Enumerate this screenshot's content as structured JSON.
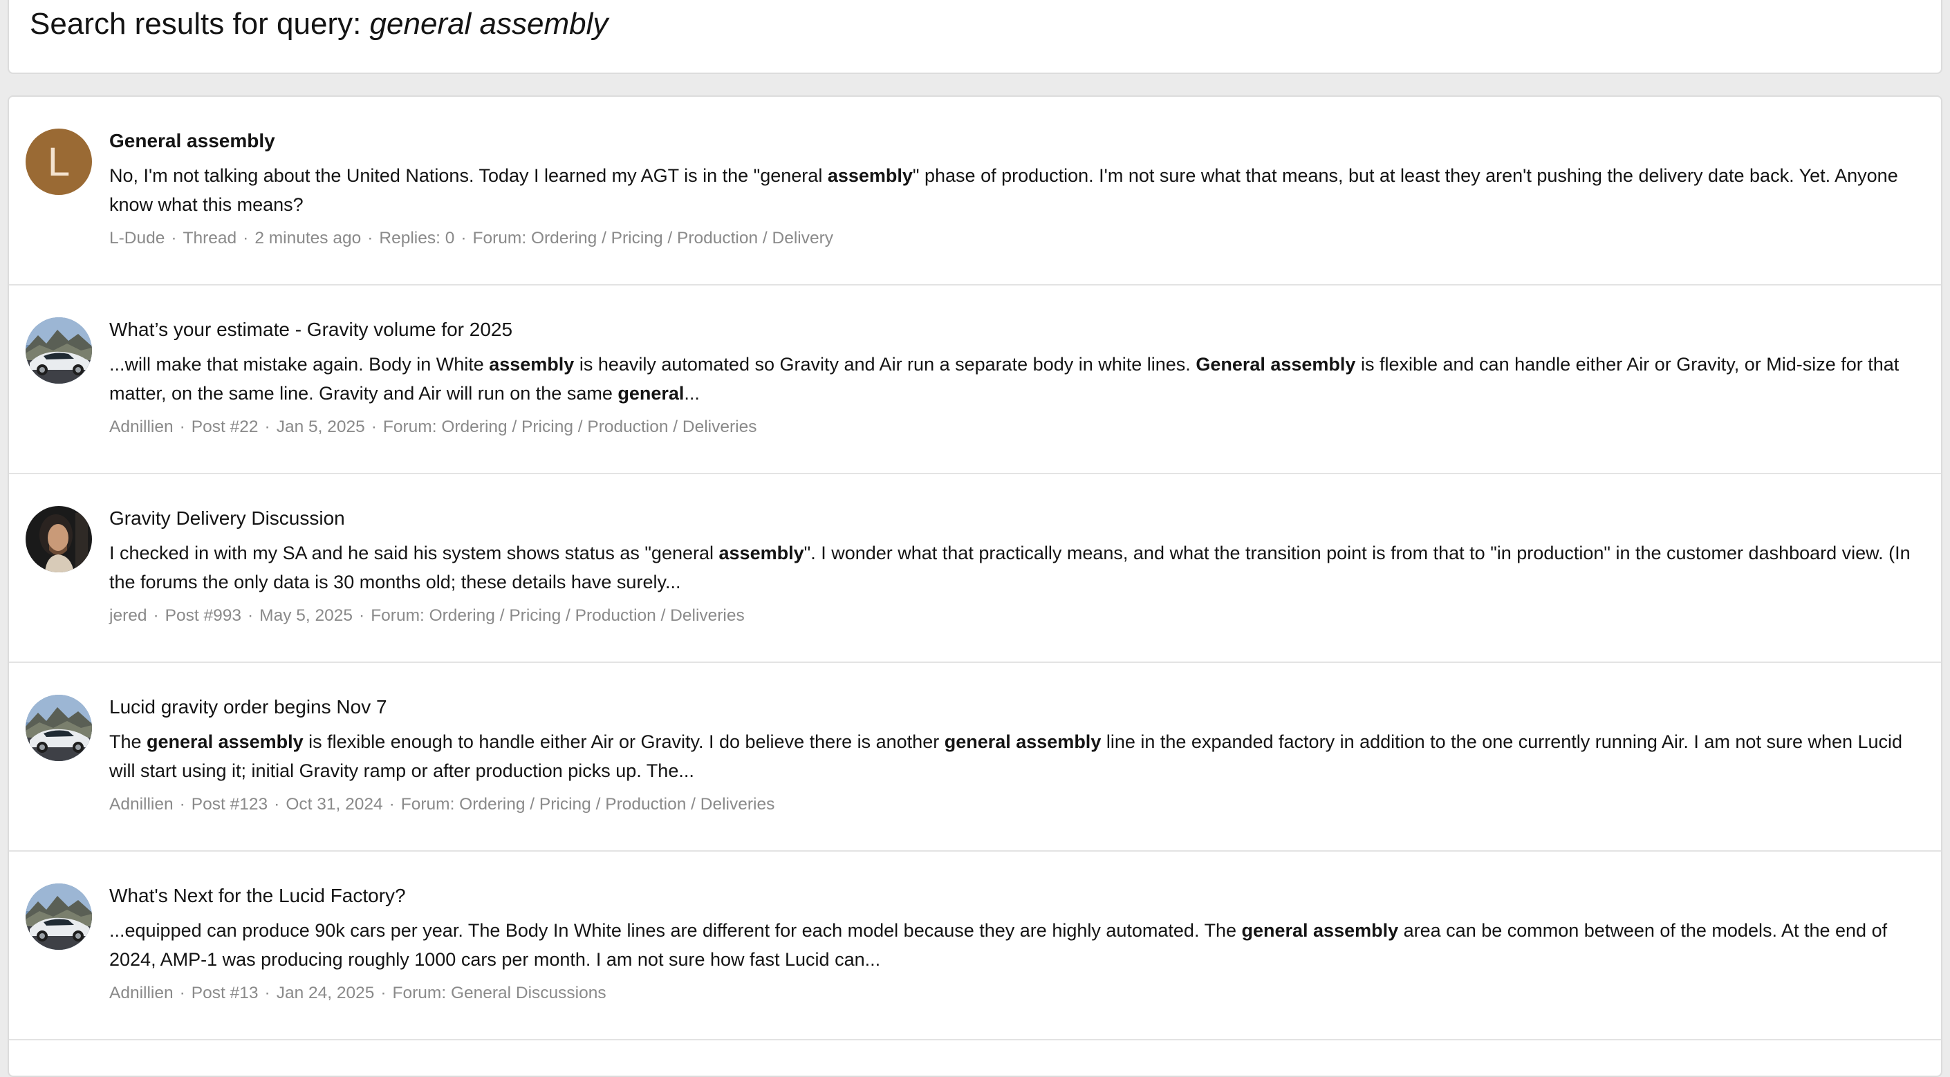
{
  "header": {
    "title_prefix": "Search results for query: ",
    "query": "general assembly"
  },
  "results": [
    {
      "title": "General assembly",
      "title_bold": true,
      "avatar": {
        "type": "letter",
        "letter": "L",
        "color": "#9a6a34"
      },
      "snippet": [
        {
          "t": "No, I'm not talking about the United Nations. Today I learned my AGT is in the \"general ",
          "b": false
        },
        {
          "t": "assembly",
          "b": true
        },
        {
          "t": "\" phase of production. I'm not sure what that means, but at least they aren't pushing the delivery date back. Yet. Anyone know what this means?",
          "b": false
        }
      ],
      "meta": [
        "L-Dude",
        "Thread",
        "2 minutes ago",
        "Replies: 0",
        "Forum: Ordering / Pricing / Production / Delivery"
      ]
    },
    {
      "title": "What’s your estimate - Gravity volume for 2025",
      "title_bold": false,
      "avatar": {
        "type": "car"
      },
      "snippet": [
        {
          "t": "...will make that mistake again. Body in White ",
          "b": false
        },
        {
          "t": "assembly",
          "b": true
        },
        {
          "t": " is heavily automated so Gravity and Air run a separate body in white lines. ",
          "b": false
        },
        {
          "t": "General assembly",
          "b": true
        },
        {
          "t": " is flexible and can handle either Air or Gravity, or Mid-size for that matter, on the same line. Gravity and Air will run on the same ",
          "b": false
        },
        {
          "t": "general",
          "b": true
        },
        {
          "t": "...",
          "b": false
        }
      ],
      "meta": [
        "Adnillien",
        "Post #22",
        "Jan 5, 2025",
        "Forum: Ordering / Pricing / Production / Deliveries"
      ]
    },
    {
      "title": "Gravity Delivery Discussion",
      "title_bold": false,
      "avatar": {
        "type": "person"
      },
      "snippet": [
        {
          "t": "I checked in with my SA and he said his system shows status as \"general ",
          "b": false
        },
        {
          "t": "assembly",
          "b": true
        },
        {
          "t": "\". I wonder what that practically means, and what the transition point is from that to \"in production\" in the customer dashboard view. (In the forums the only data is 30 months old; these details have surely...",
          "b": false
        }
      ],
      "meta": [
        "jered",
        "Post #993",
        "May 5, 2025",
        "Forum: Ordering / Pricing / Production / Deliveries"
      ]
    },
    {
      "title": "Lucid gravity order begins Nov 7",
      "title_bold": false,
      "avatar": {
        "type": "car"
      },
      "snippet": [
        {
          "t": "The ",
          "b": false
        },
        {
          "t": "general assembly",
          "b": true
        },
        {
          "t": " is flexible enough to handle either Air or Gravity. I do believe there is another ",
          "b": false
        },
        {
          "t": "general assembly",
          "b": true
        },
        {
          "t": " line in the expanded factory in addition to the one currently running Air. I am not sure when Lucid will start using it; initial Gravity ramp or after production picks up. The...",
          "b": false
        }
      ],
      "meta": [
        "Adnillien",
        "Post #123",
        "Oct 31, 2024",
        "Forum: Ordering / Pricing / Production / Deliveries"
      ]
    },
    {
      "title": "What's Next for the Lucid Factory?",
      "title_bold": false,
      "avatar": {
        "type": "car"
      },
      "snippet": [
        {
          "t": "...equipped can produce 90k cars per year. The Body In White lines are different for each model because they are highly automated. The ",
          "b": false
        },
        {
          "t": "general assembly",
          "b": true
        },
        {
          "t": " area can be common between of the models. At the end of 2024, AMP-1 was producing roughly 1000 cars per month. I am not sure how fast Lucid can...",
          "b": false
        }
      ],
      "meta": [
        "Adnillien",
        "Post #13",
        "Jan 24, 2025",
        "Forum: General Discussions"
      ]
    }
  ]
}
